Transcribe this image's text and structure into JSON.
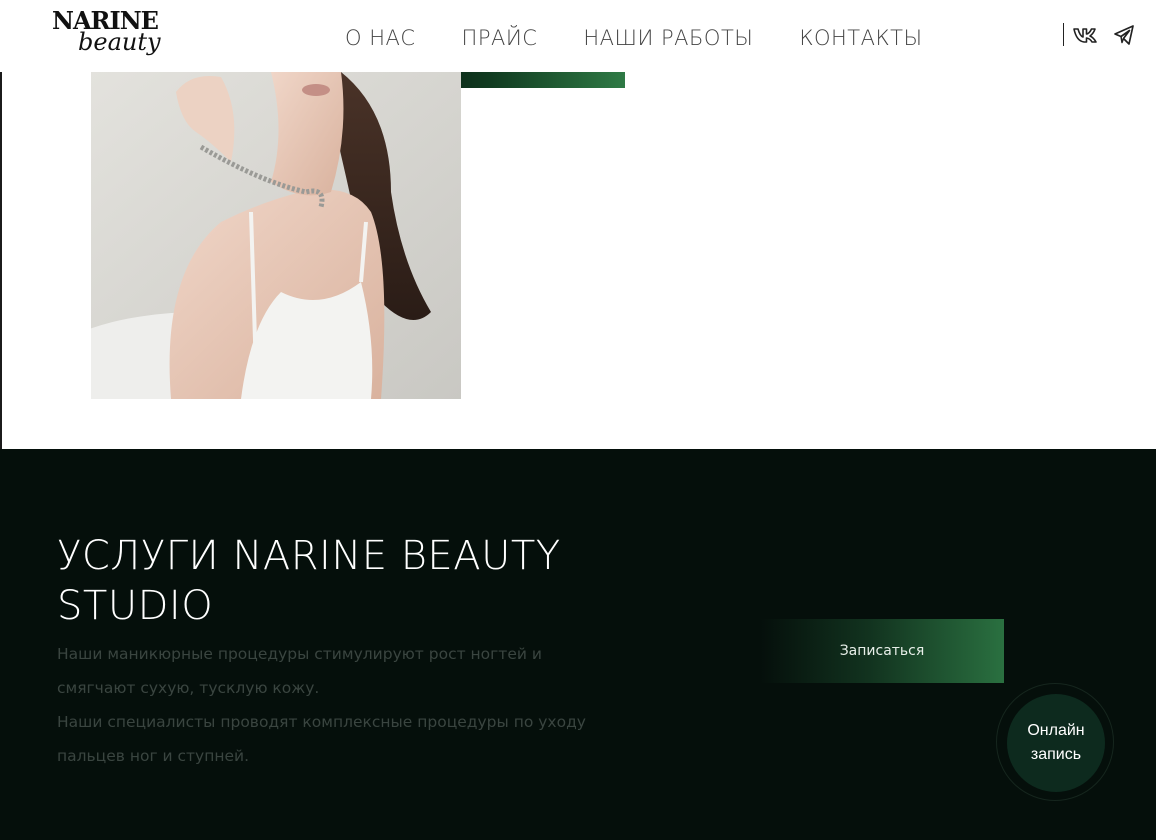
{
  "logo": {
    "top_text": "NARINE",
    "bottom_text": "beauty"
  },
  "nav": {
    "items": [
      {
        "label": "О НАС"
      },
      {
        "label": "ПРАЙС"
      },
      {
        "label": "НАШИ РАБОТЫ"
      },
      {
        "label": "КОНТАКТЫ"
      }
    ]
  },
  "social": {
    "icons": [
      "vk-icon",
      "telegram-icon"
    ]
  },
  "services": {
    "title_line1": "УСЛУГИ NARINE BEAUTY",
    "title_line2": "STUDIO",
    "paragraph1": "Наши маникюрные процедуры стимулируют рост ногтей и смягчают сухую, тусклую кожу.",
    "paragraph2": "Наши специалисты проводят комплексные процедуры по уходу пальцев ног и ступней.",
    "cta_label": "Записаться"
  },
  "online_booking": {
    "line1": "Онлайн",
    "line2": "запись"
  },
  "colors": {
    "dark_bg": "#050f0b",
    "accent_green": "#2f7a45",
    "text_muted": "#3a4540"
  }
}
